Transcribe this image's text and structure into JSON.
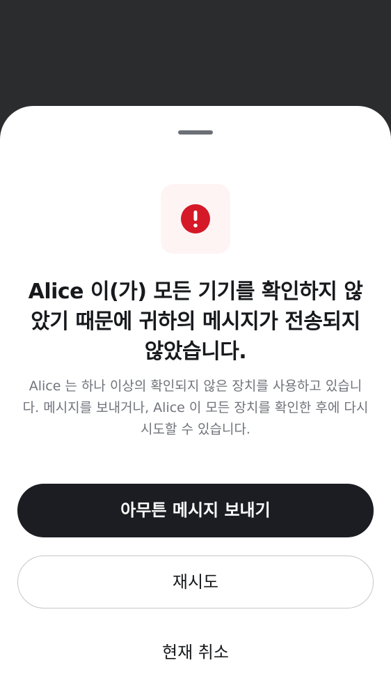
{
  "dialog": {
    "icon": "exclamation-circle-icon",
    "accent_color": "#d51928",
    "title": "Alice 이(가) 모든 기기를 확인하지 않았기 때문에 귀하의 메시지가 전송되지 않았습니다.",
    "description": "Alice 는 하나 이상의 확인되지 않은 장치를 사용하고 있습니다. 메시지를 보내거나, Alice 이 모든 장치를 확인한 후에 다시 시도할 수 있습니다.",
    "buttons": {
      "send_anyway": "아무튼 메시지 보내기",
      "retry": "재시도",
      "cancel": "현재 취소"
    }
  }
}
